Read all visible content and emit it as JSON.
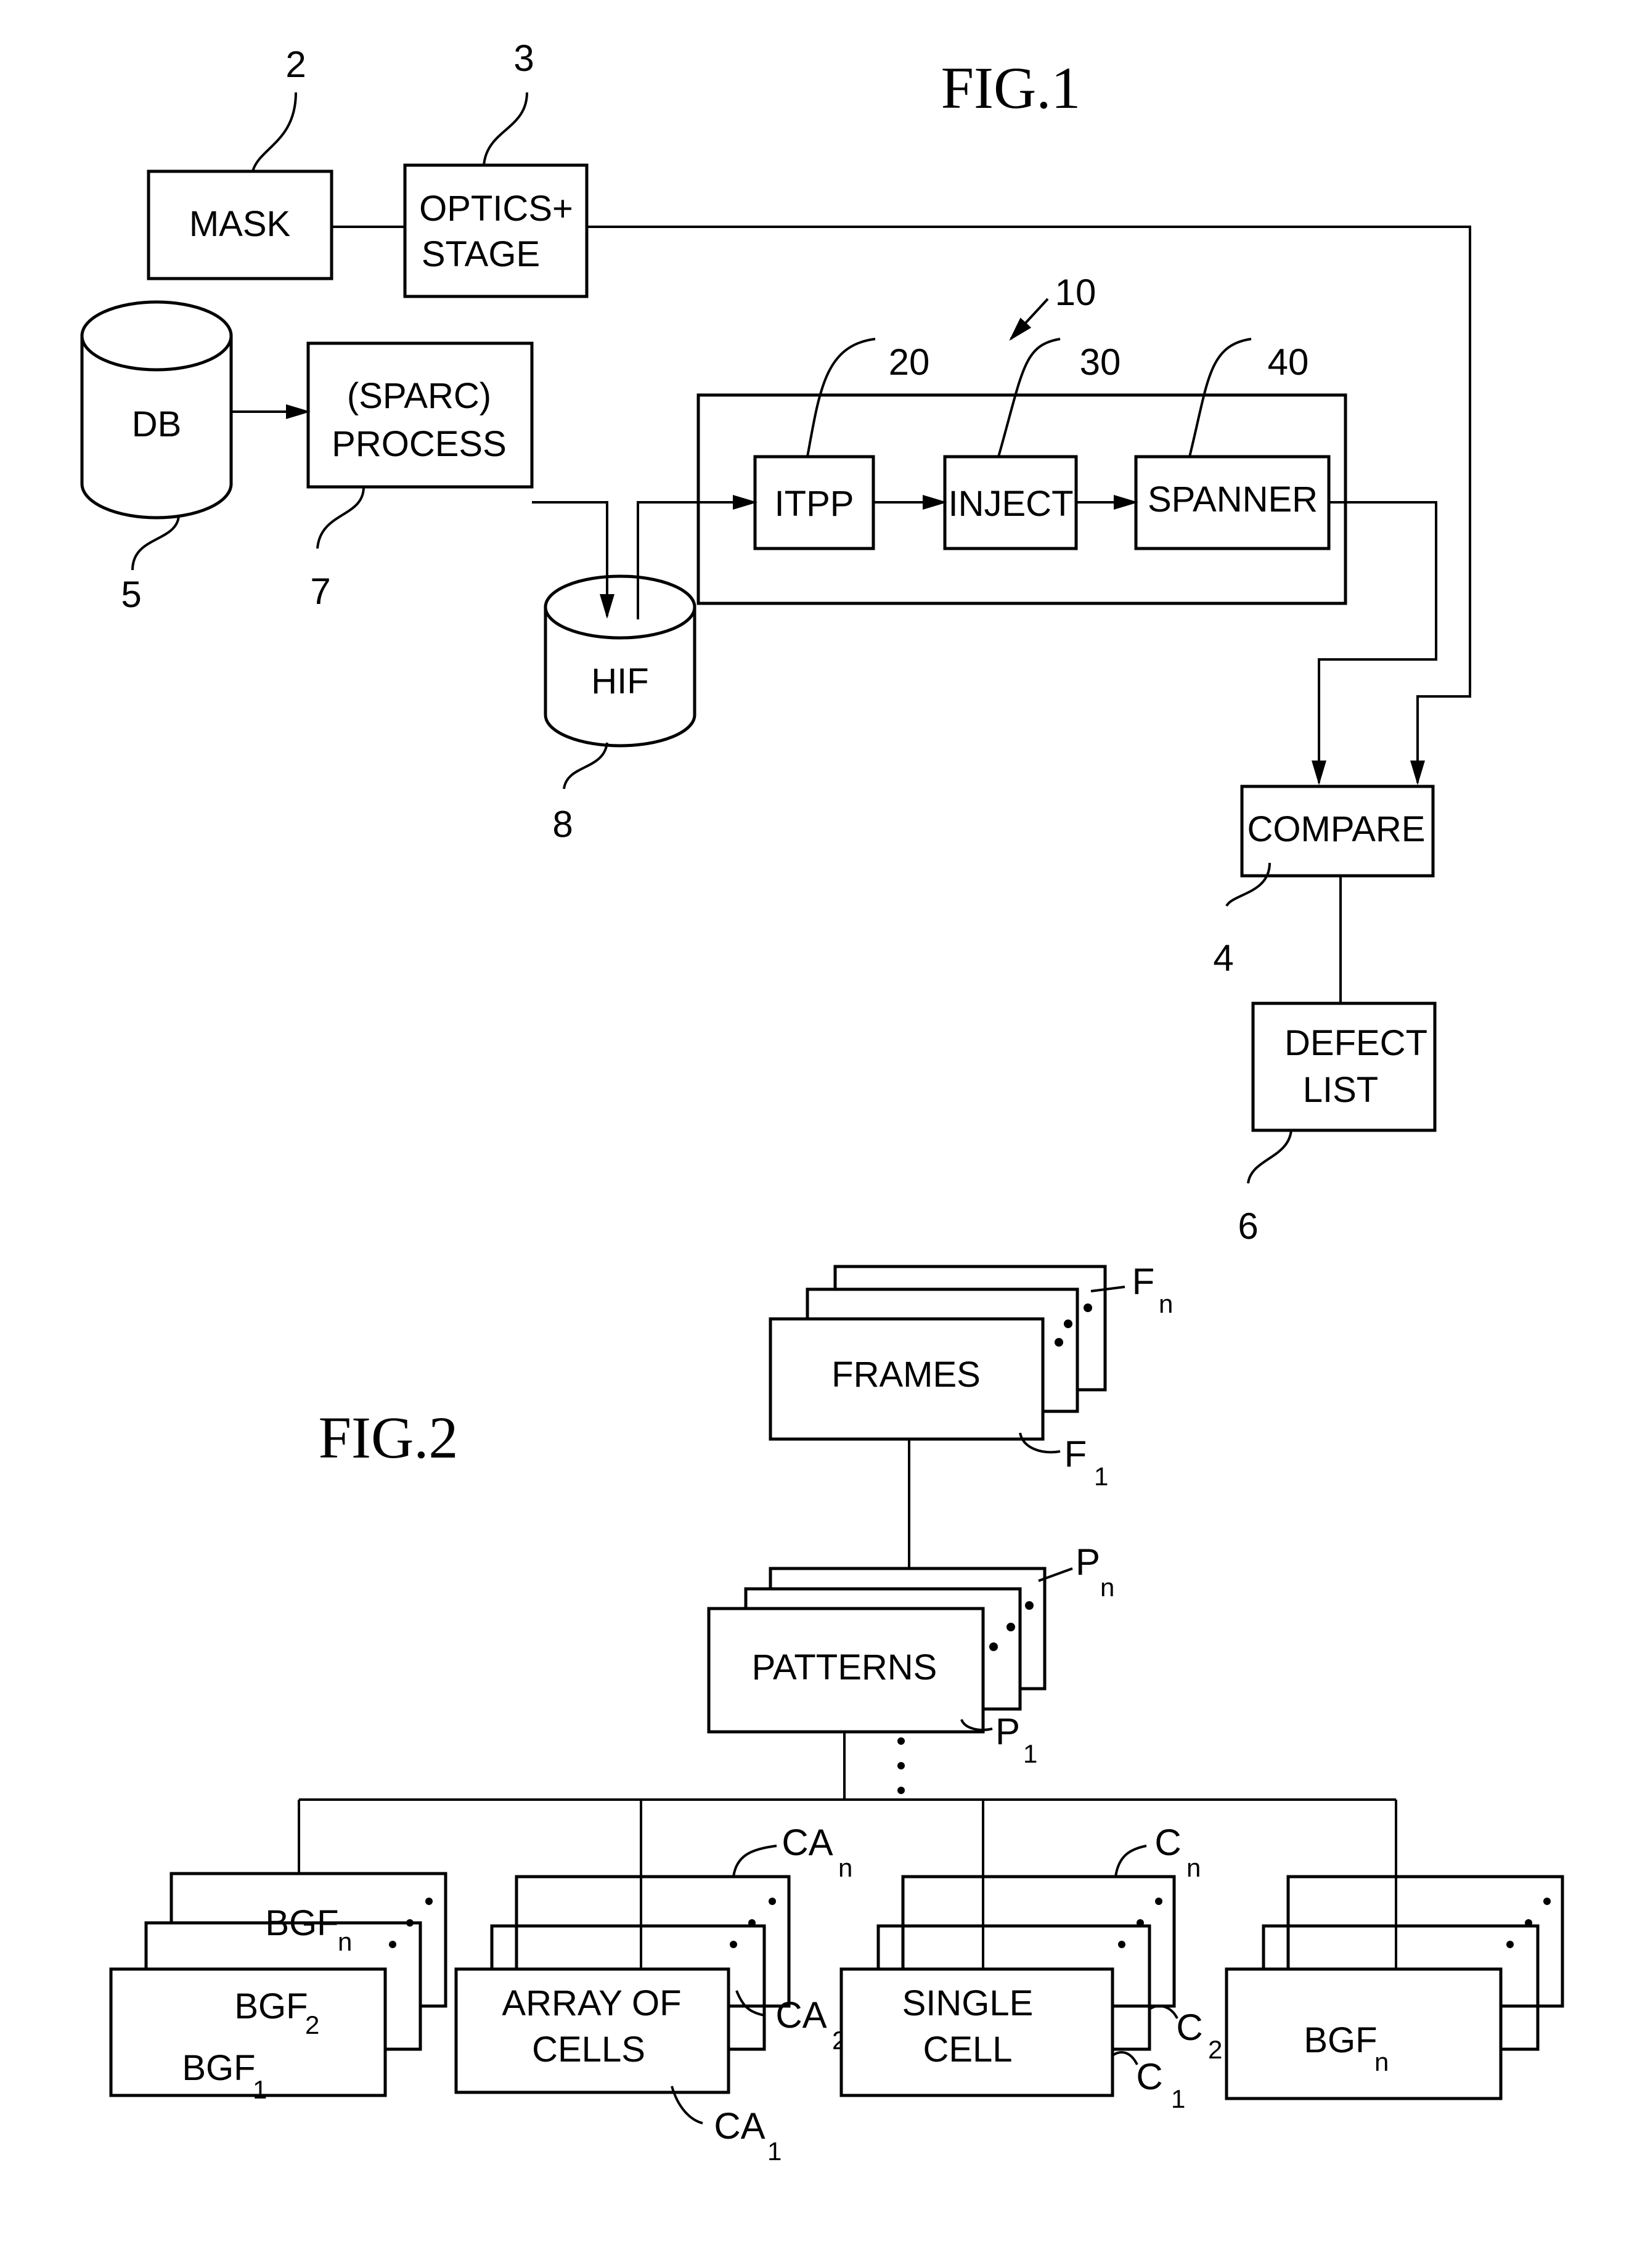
{
  "fig1": {
    "title": "FIG.1",
    "blocks": {
      "mask": "MASK",
      "optics_l1": "OPTICS+",
      "optics_l2": "STAGE",
      "db": "DB",
      "sparc_l1": "(SPARC)",
      "sparc_l2": "PROCESS",
      "itpp": "ITPP",
      "inject": "INJECT",
      "spanner": "SPANNER",
      "hif": "HIF",
      "compare": "COMPARE",
      "defect_l1": "DEFECT",
      "defect_l2": "LIST"
    },
    "refs": {
      "mask": "2",
      "optics": "3",
      "compare": "4",
      "db": "5",
      "defect": "6",
      "sparc": "7",
      "hif": "8",
      "system": "10",
      "itpp": "20",
      "inject": "30",
      "spanner": "40"
    }
  },
  "fig2": {
    "title": "FIG.2",
    "frames": "FRAMES",
    "patterns": "PATTERNS",
    "array_l1": "ARRAY  OF",
    "array_l2": "CELLS",
    "single_l1": "SINGLE",
    "single_l2": "CELL",
    "bgf": "BGF",
    "refs": {
      "F": "F",
      "P": "P",
      "CA": "CA",
      "C": "C",
      "sub_n": "n",
      "sub_1": "1",
      "sub_2": "2"
    }
  }
}
